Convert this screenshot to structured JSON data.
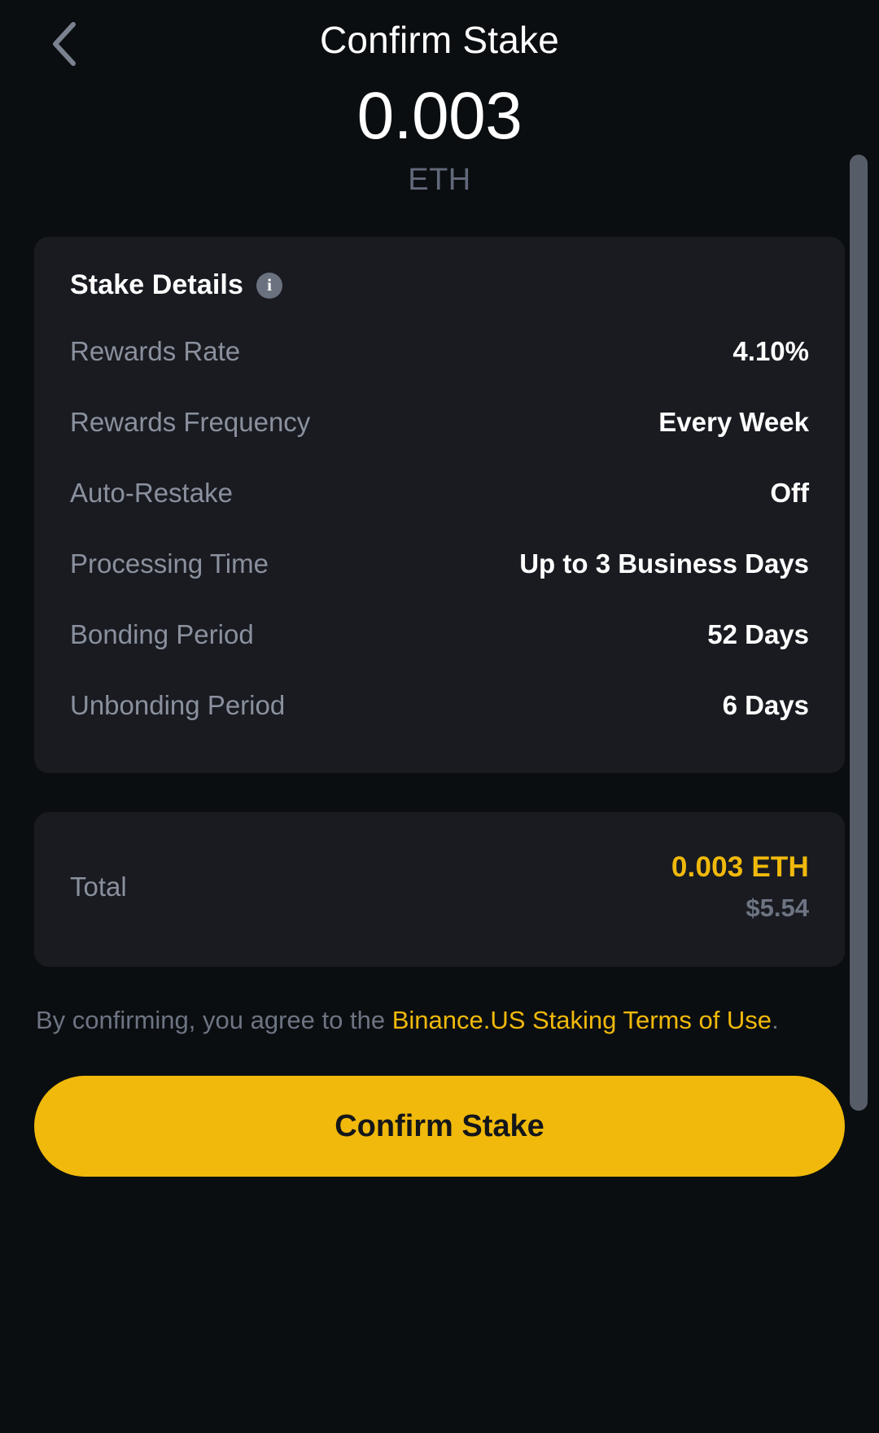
{
  "header": {
    "back_icon": "chevron-left-icon",
    "title": "Confirm Stake"
  },
  "amount": {
    "value": "0.003",
    "symbol": "ETH"
  },
  "stake_details": {
    "title": "Stake Details",
    "info_icon": "info-icon",
    "info_glyph": "i",
    "rows": [
      {
        "label": "Rewards Rate",
        "value": "4.10%"
      },
      {
        "label": "Rewards Frequency",
        "value": "Every Week"
      },
      {
        "label": "Auto-Restake",
        "value": "Off"
      },
      {
        "label": "Processing Time",
        "value": "Up to 3 Business Days"
      },
      {
        "label": "Bonding Period",
        "value": "52 Days"
      },
      {
        "label": "Unbonding Period",
        "value": "6 Days"
      }
    ]
  },
  "total": {
    "label": "Total",
    "crypto": "0.003 ETH",
    "fiat": "$5.54"
  },
  "terms": {
    "prefix": "By confirming, you agree to the ",
    "link": "Binance.US Staking Terms of Use",
    "suffix": "."
  },
  "confirm_button": {
    "label": "Confirm Stake"
  },
  "colors": {
    "accent": "#f0b90b",
    "page_bg": "#0b0e11",
    "card_bg": "#191b21",
    "muted_text": "#8a909d",
    "scrollbar": "#565d68"
  }
}
